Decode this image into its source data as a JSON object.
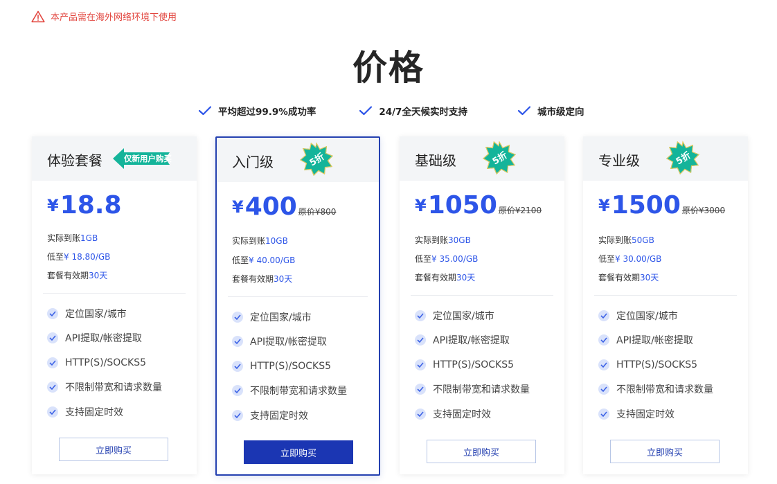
{
  "notice": {
    "text": "本产品需在海外网络环境下使用",
    "icon": "warning-triangle-icon",
    "color": "#e2463f"
  },
  "page": {
    "title": "价格"
  },
  "features": [
    {
      "label": "平均超过99.9%成功率",
      "icon": "check-icon"
    },
    {
      "label": "24/7全天候实时支持",
      "icon": "check-icon"
    },
    {
      "label": "城市级定向",
      "icon": "check-icon"
    }
  ],
  "plans": [
    {
      "name": "体验套餐",
      "badge": "仅新用户购买",
      "badge_color": "#14b49a",
      "currency": "¥",
      "price": "18.8",
      "original_price": "",
      "received_label": "实际到账",
      "received_value": "1GB",
      "unit_label": "低至",
      "unit_value": "¥ 18.80/GB",
      "valid_label": "套餐有效期",
      "valid_value": "30天",
      "features": [
        "定位国家/城市",
        "API提取/帐密提取",
        "HTTP(S)/SOCKS5",
        "不限制带宽和请求数量",
        "支持固定时效"
      ],
      "button": "立即购买",
      "featured": false
    },
    {
      "name": "入门级",
      "badge": "5折",
      "badge_color": "#14b49a",
      "currency": "¥",
      "price": "400",
      "original_price": "原价¥800",
      "received_label": "实际到账",
      "received_value": "10GB",
      "unit_label": "低至",
      "unit_value": "¥ 40.00/GB",
      "valid_label": "套餐有效期",
      "valid_value": "30天",
      "features": [
        "定位国家/城市",
        "API提取/帐密提取",
        "HTTP(S)/SOCKS5",
        "不限制带宽和请求数量",
        "支持固定时效"
      ],
      "button": "立即购买",
      "featured": true
    },
    {
      "name": "基础级",
      "badge": "5折",
      "badge_color": "#14b49a",
      "currency": "¥",
      "price": "1050",
      "original_price": "原价¥2100",
      "received_label": "实际到账",
      "received_value": "30GB",
      "unit_label": "低至",
      "unit_value": "¥ 35.00/GB",
      "valid_label": "套餐有效期",
      "valid_value": "30天",
      "features": [
        "定位国家/城市",
        "API提取/帐密提取",
        "HTTP(S)/SOCKS5",
        "不限制带宽和请求数量",
        "支持固定时效"
      ],
      "button": "立即购买",
      "featured": false
    },
    {
      "name": "专业级",
      "badge": "5折",
      "badge_color": "#14b49a",
      "currency": "¥",
      "price": "1500",
      "original_price": "原价¥3000",
      "received_label": "实际到账",
      "received_value": "50GB",
      "unit_label": "低至",
      "unit_value": "¥ 30.00/GB",
      "valid_label": "套餐有效期",
      "valid_value": "30天",
      "features": [
        "定位国家/城市",
        "API提取/帐密提取",
        "HTTP(S)/SOCKS5",
        "不限制带宽和请求数量",
        "支持固定时效"
      ],
      "button": "立即购买",
      "featured": false
    }
  ],
  "colors": {
    "accent": "#2d55e8",
    "button_primary": "#1b36b3",
    "badge": "#14b49a"
  }
}
